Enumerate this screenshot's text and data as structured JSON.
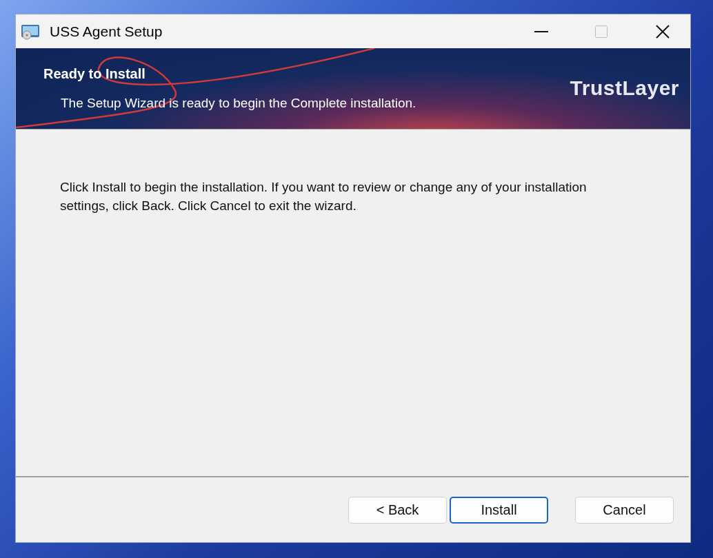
{
  "window": {
    "title": "USS Agent Setup"
  },
  "banner": {
    "title": "Ready to Install",
    "subtitle": "The Setup Wizard is ready to begin the Complete installation.",
    "logo": "TrustLayer"
  },
  "body": {
    "text": "Click Install to begin the installation. If you want to review or change any of your installation settings, click Back. Click Cancel to exit the wizard."
  },
  "buttons": [
    {
      "label": "< Back",
      "default": false
    },
    {
      "label": "Install",
      "default": true
    },
    {
      "label": "Cancel",
      "default": false
    }
  ]
}
